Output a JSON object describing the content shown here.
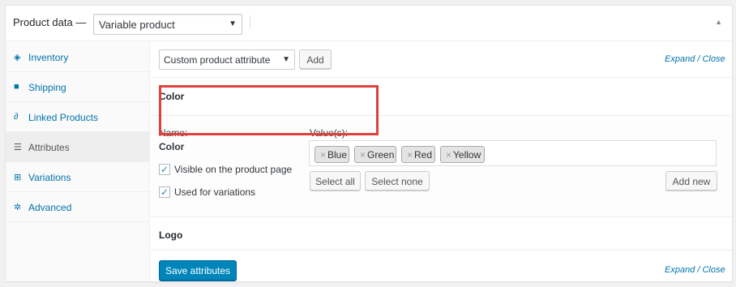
{
  "header": {
    "title": "Product data —",
    "product_type": "Variable product",
    "collapse_icon": "triangle-up-icon"
  },
  "sidebar": {
    "items": [
      {
        "label": "Inventory",
        "icon": "tag-icon"
      },
      {
        "label": "Shipping",
        "icon": "truck-icon"
      },
      {
        "label": "Linked Products",
        "icon": "link-icon"
      },
      {
        "label": "Attributes",
        "icon": "list-icon",
        "active": true
      },
      {
        "label": "Variations",
        "icon": "grid-icon"
      },
      {
        "label": "Advanced",
        "icon": "gear-icon"
      }
    ]
  },
  "toolbar": {
    "attribute_select": "Custom product attribute",
    "add_label": "Add",
    "expand_close": "Expand / Close"
  },
  "attribute": {
    "title": "Color",
    "name_label": "Name:",
    "name_value": "Color",
    "values_label": "Value(s):",
    "values": [
      "Blue",
      "Green",
      "Red",
      "Yellow"
    ],
    "visible_label": "Visible on the product page",
    "visible_checked": true,
    "variations_label": "Used for variations",
    "variations_checked": true,
    "select_all": "Select all",
    "select_none": "Select none",
    "add_new": "Add new"
  },
  "logo_section": {
    "title": "Logo"
  },
  "footer": {
    "save_label": "Save attributes",
    "expand_close": "Expand / Close"
  },
  "colors": {
    "primary": "#0085ba",
    "link": "#0073aa",
    "highlight": "#e2403d"
  }
}
